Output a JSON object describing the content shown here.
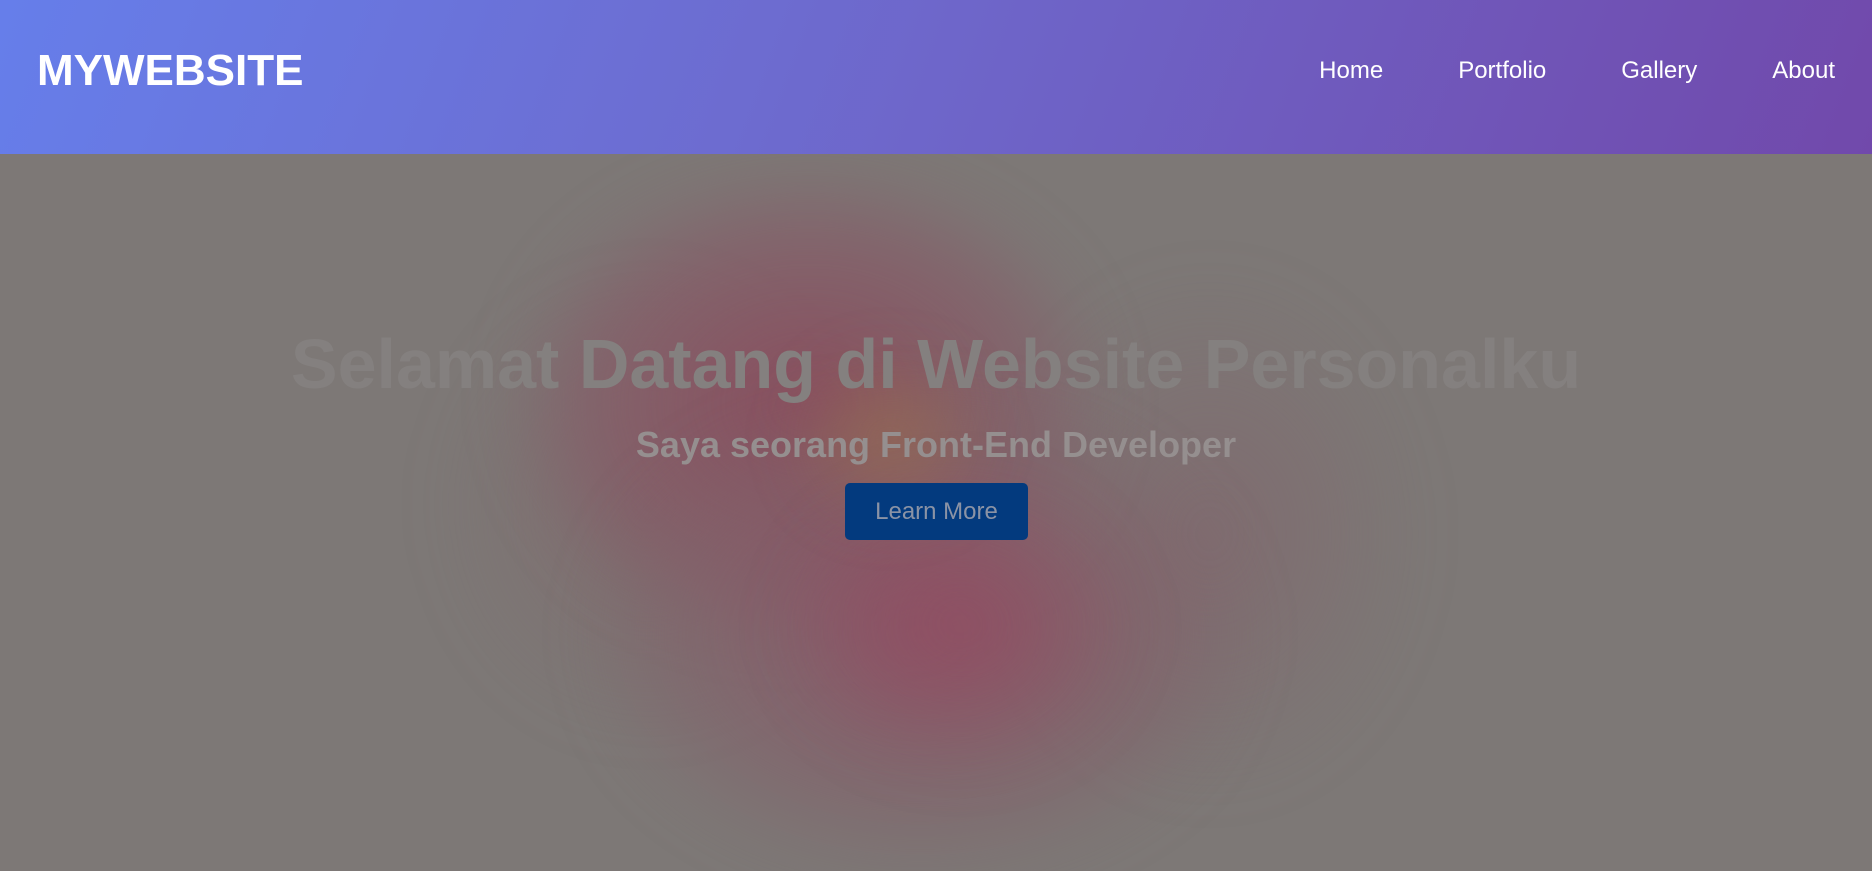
{
  "header": {
    "logo": "MYWEBSITE",
    "nav": [
      {
        "label": "Home"
      },
      {
        "label": "Portfolio"
      },
      {
        "label": "Gallery"
      },
      {
        "label": "About"
      }
    ]
  },
  "hero": {
    "title": "Selamat Datang di Website Personalku",
    "subtitle": "Saya seorang Front-End Developer",
    "button_label": "Learn More"
  },
  "colors": {
    "header_gradient_start": "#667eea",
    "header_gradient_end": "#764ba2",
    "overlay": "#7d7876",
    "button": "#033a7e"
  }
}
